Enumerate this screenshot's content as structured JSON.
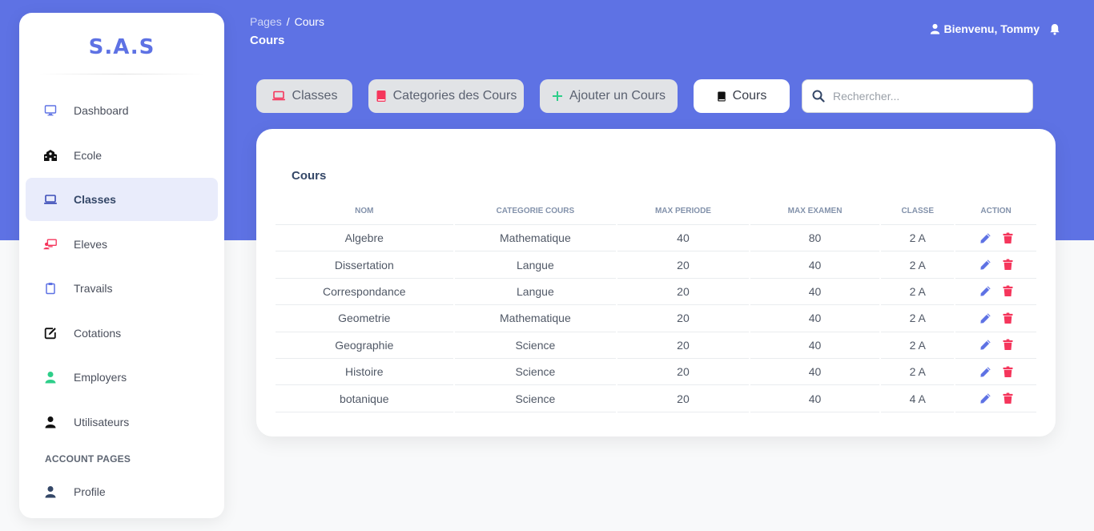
{
  "colors": {
    "primary": "#5e72e4",
    "danger": "#f5365c",
    "success": "#2dce89"
  },
  "sidebar": {
    "brand": "S.A.S",
    "items": [
      {
        "label": "Dashboard",
        "icon": "monitor-icon",
        "active": false
      },
      {
        "label": "Ecole",
        "icon": "school-icon",
        "active": false
      },
      {
        "label": "Classes",
        "icon": "laptop-icon",
        "active": true
      },
      {
        "label": "Eleves",
        "icon": "teacher-board-icon",
        "active": false
      },
      {
        "label": "Travails",
        "icon": "clipboard-icon",
        "active": false
      },
      {
        "label": "Cotations",
        "icon": "edit-icon",
        "active": false
      },
      {
        "label": "Employers",
        "icon": "user-icon",
        "active": false
      },
      {
        "label": "Utilisateurs",
        "icon": "user-icon",
        "active": false
      }
    ],
    "section_label": "ACCOUNT PAGES",
    "account_items": [
      {
        "label": "Profile",
        "icon": "user-icon"
      }
    ]
  },
  "header": {
    "breadcrumb_root": "Pages",
    "breadcrumb_sep": "/",
    "breadcrumb_current": "Cours",
    "title": "Cours",
    "welcome": "Bienvenu, Tommy"
  },
  "toolbar": {
    "classes_label": "Classes",
    "categories_label": "Categories des Cours",
    "add_label": "Ajouter un Cours",
    "cours_label": "Cours",
    "search_placeholder": "Rechercher..."
  },
  "table": {
    "title": "Cours",
    "headers": [
      "Nom",
      "Categorie cours",
      "Max periode",
      "Max examen",
      "Classe",
      "Action"
    ],
    "rows": [
      [
        "Algebre",
        "Mathematique",
        "40",
        "80",
        "2 A"
      ],
      [
        "Dissertation",
        "Langue",
        "20",
        "40",
        "2 A"
      ],
      [
        "Correspondance",
        "Langue",
        "20",
        "40",
        "2 A"
      ],
      [
        "Geometrie",
        "Mathematique",
        "20",
        "40",
        "2 A"
      ],
      [
        "Geographie",
        "Science",
        "20",
        "40",
        "2 A"
      ],
      [
        "Histoire",
        "Science",
        "20",
        "40",
        "2 A"
      ],
      [
        "botanique",
        "Science",
        "20",
        "40",
        "4 A"
      ]
    ]
  }
}
